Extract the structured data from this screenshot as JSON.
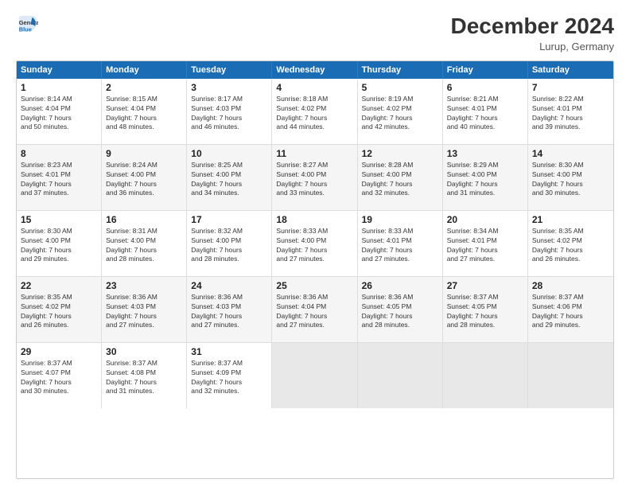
{
  "header": {
    "logo_line1": "General",
    "logo_line2": "Blue",
    "title": "December 2024",
    "subtitle": "Lurup, Germany"
  },
  "days_of_week": [
    "Sunday",
    "Monday",
    "Tuesday",
    "Wednesday",
    "Thursday",
    "Friday",
    "Saturday"
  ],
  "weeks": [
    [
      {
        "day": "1",
        "info": "Sunrise: 8:14 AM\nSunset: 4:04 PM\nDaylight: 7 hours\nand 50 minutes."
      },
      {
        "day": "2",
        "info": "Sunrise: 8:15 AM\nSunset: 4:04 PM\nDaylight: 7 hours\nand 48 minutes."
      },
      {
        "day": "3",
        "info": "Sunrise: 8:17 AM\nSunset: 4:03 PM\nDaylight: 7 hours\nand 46 minutes."
      },
      {
        "day": "4",
        "info": "Sunrise: 8:18 AM\nSunset: 4:02 PM\nDaylight: 7 hours\nand 44 minutes."
      },
      {
        "day": "5",
        "info": "Sunrise: 8:19 AM\nSunset: 4:02 PM\nDaylight: 7 hours\nand 42 minutes."
      },
      {
        "day": "6",
        "info": "Sunrise: 8:21 AM\nSunset: 4:01 PM\nDaylight: 7 hours\nand 40 minutes."
      },
      {
        "day": "7",
        "info": "Sunrise: 8:22 AM\nSunset: 4:01 PM\nDaylight: 7 hours\nand 39 minutes."
      }
    ],
    [
      {
        "day": "8",
        "info": "Sunrise: 8:23 AM\nSunset: 4:01 PM\nDaylight: 7 hours\nand 37 minutes."
      },
      {
        "day": "9",
        "info": "Sunrise: 8:24 AM\nSunset: 4:00 PM\nDaylight: 7 hours\nand 36 minutes."
      },
      {
        "day": "10",
        "info": "Sunrise: 8:25 AM\nSunset: 4:00 PM\nDaylight: 7 hours\nand 34 minutes."
      },
      {
        "day": "11",
        "info": "Sunrise: 8:27 AM\nSunset: 4:00 PM\nDaylight: 7 hours\nand 33 minutes."
      },
      {
        "day": "12",
        "info": "Sunrise: 8:28 AM\nSunset: 4:00 PM\nDaylight: 7 hours\nand 32 minutes."
      },
      {
        "day": "13",
        "info": "Sunrise: 8:29 AM\nSunset: 4:00 PM\nDaylight: 7 hours\nand 31 minutes."
      },
      {
        "day": "14",
        "info": "Sunrise: 8:30 AM\nSunset: 4:00 PM\nDaylight: 7 hours\nand 30 minutes."
      }
    ],
    [
      {
        "day": "15",
        "info": "Sunrise: 8:30 AM\nSunset: 4:00 PM\nDaylight: 7 hours\nand 29 minutes."
      },
      {
        "day": "16",
        "info": "Sunrise: 8:31 AM\nSunset: 4:00 PM\nDaylight: 7 hours\nand 28 minutes."
      },
      {
        "day": "17",
        "info": "Sunrise: 8:32 AM\nSunset: 4:00 PM\nDaylight: 7 hours\nand 28 minutes."
      },
      {
        "day": "18",
        "info": "Sunrise: 8:33 AM\nSunset: 4:00 PM\nDaylight: 7 hours\nand 27 minutes."
      },
      {
        "day": "19",
        "info": "Sunrise: 8:33 AM\nSunset: 4:01 PM\nDaylight: 7 hours\nand 27 minutes."
      },
      {
        "day": "20",
        "info": "Sunrise: 8:34 AM\nSunset: 4:01 PM\nDaylight: 7 hours\nand 27 minutes."
      },
      {
        "day": "21",
        "info": "Sunrise: 8:35 AM\nSunset: 4:02 PM\nDaylight: 7 hours\nand 26 minutes."
      }
    ],
    [
      {
        "day": "22",
        "info": "Sunrise: 8:35 AM\nSunset: 4:02 PM\nDaylight: 7 hours\nand 26 minutes."
      },
      {
        "day": "23",
        "info": "Sunrise: 8:36 AM\nSunset: 4:03 PM\nDaylight: 7 hours\nand 27 minutes."
      },
      {
        "day": "24",
        "info": "Sunrise: 8:36 AM\nSunset: 4:03 PM\nDaylight: 7 hours\nand 27 minutes."
      },
      {
        "day": "25",
        "info": "Sunrise: 8:36 AM\nSunset: 4:04 PM\nDaylight: 7 hours\nand 27 minutes."
      },
      {
        "day": "26",
        "info": "Sunrise: 8:36 AM\nSunset: 4:05 PM\nDaylight: 7 hours\nand 28 minutes."
      },
      {
        "day": "27",
        "info": "Sunrise: 8:37 AM\nSunset: 4:05 PM\nDaylight: 7 hours\nand 28 minutes."
      },
      {
        "day": "28",
        "info": "Sunrise: 8:37 AM\nSunset: 4:06 PM\nDaylight: 7 hours\nand 29 minutes."
      }
    ],
    [
      {
        "day": "29",
        "info": "Sunrise: 8:37 AM\nSunset: 4:07 PM\nDaylight: 7 hours\nand 30 minutes."
      },
      {
        "day": "30",
        "info": "Sunrise: 8:37 AM\nSunset: 4:08 PM\nDaylight: 7 hours\nand 31 minutes."
      },
      {
        "day": "31",
        "info": "Sunrise: 8:37 AM\nSunset: 4:09 PM\nDaylight: 7 hours\nand 32 minutes."
      },
      {
        "day": "",
        "info": ""
      },
      {
        "day": "",
        "info": ""
      },
      {
        "day": "",
        "info": ""
      },
      {
        "day": "",
        "info": ""
      }
    ]
  ]
}
